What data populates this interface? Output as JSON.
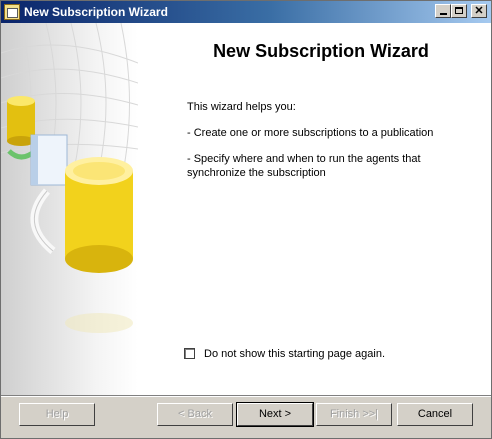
{
  "window": {
    "title": "New Subscription Wizard"
  },
  "main": {
    "heading": "New Subscription Wizard",
    "intro": "This wizard helps you:",
    "bullet_1": "- Create one or more subscriptions to a publication",
    "bullet_2": "- Specify where and when to run the agents that synchronize the subscription"
  },
  "checkbox": {
    "label": "Do not show this starting page again.",
    "checked": false
  },
  "buttons": {
    "help": "Help",
    "back": "< Back",
    "next": "Next >",
    "finish": "Finish >>|",
    "cancel": "Cancel"
  },
  "colors": {
    "titlebar_start": "#0a246a",
    "titlebar_end": "#a6caf0",
    "dialog_face": "#d4d0c8",
    "cylinder_yellow": "#f2d21c"
  }
}
